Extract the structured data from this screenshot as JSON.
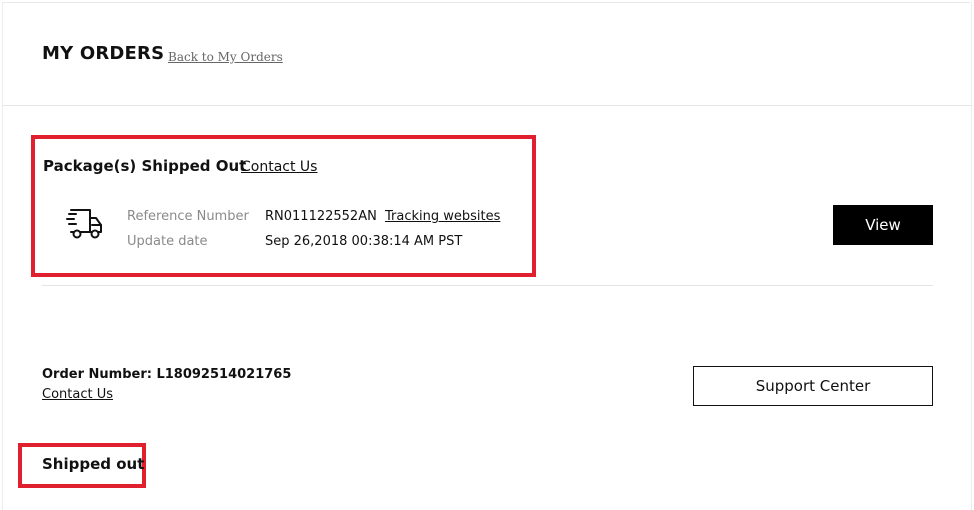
{
  "header": {
    "title": "MY ORDERS",
    "back_link": "Back to My Orders"
  },
  "package": {
    "title": "Package(s) Shipped Out",
    "contact_link": "Contact Us",
    "reference_label": "Reference Number",
    "reference_value": "RN011122552AN",
    "tracking_link": "Tracking websites",
    "update_label": "Update date",
    "update_value": "Sep 26,2018 00:38:14 AM PST",
    "view_button": "View"
  },
  "order": {
    "number_text": "Order Number: L18092514021765",
    "contact_link": "Contact Us",
    "support_button": "Support Center",
    "status": "Shipped out"
  },
  "colors": {
    "highlight": "#e0202e",
    "button_dark": "#000000"
  },
  "icons": [
    "delivery-truck-icon"
  ]
}
